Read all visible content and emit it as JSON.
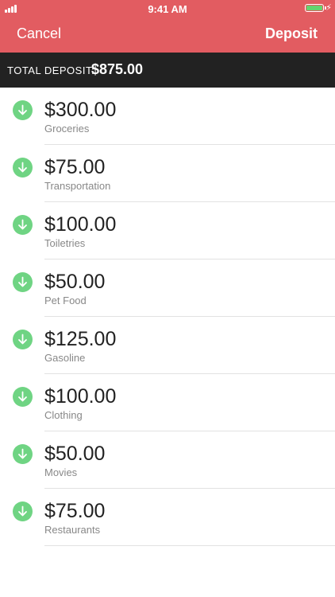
{
  "status_bar": {
    "time": "9:41 AM"
  },
  "nav": {
    "cancel_label": "Cancel",
    "deposit_label": "Deposit"
  },
  "total": {
    "label": "TOTAL DEPOSIT:",
    "amount": "$875.00"
  },
  "colors": {
    "header": "#e25c61",
    "total_bar": "#222222",
    "icon": "#6fd483"
  },
  "items": [
    {
      "amount": "$300.00",
      "category": "Groceries",
      "icon": "arrow-down-icon"
    },
    {
      "amount": "$75.00",
      "category": "Transportation",
      "icon": "arrow-down-icon"
    },
    {
      "amount": "$100.00",
      "category": "Toiletries",
      "icon": "arrow-down-icon"
    },
    {
      "amount": "$50.00",
      "category": "Pet Food",
      "icon": "arrow-down-icon"
    },
    {
      "amount": "$125.00",
      "category": "Gasoline",
      "icon": "arrow-down-icon"
    },
    {
      "amount": "$100.00",
      "category": "Clothing",
      "icon": "arrow-down-icon"
    },
    {
      "amount": "$50.00",
      "category": "Movies",
      "icon": "arrow-down-icon"
    },
    {
      "amount": "$75.00",
      "category": "Restaurants",
      "icon": "arrow-down-icon"
    }
  ]
}
